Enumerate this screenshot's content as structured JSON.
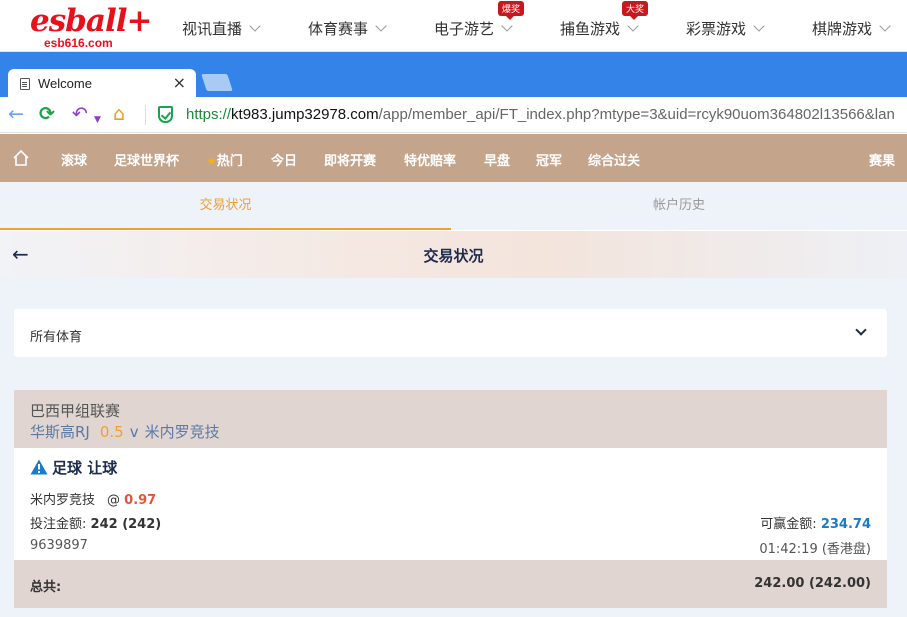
{
  "site": {
    "logo_text": "esball+",
    "logo_domain": "esb616.com",
    "nav": [
      {
        "label": "视讯直播",
        "badge": ""
      },
      {
        "label": "体育赛事",
        "badge": ""
      },
      {
        "label": "电子游艺",
        "badge": "爆奖"
      },
      {
        "label": "捕鱼游戏",
        "badge": "大奖"
      },
      {
        "label": "彩票游戏",
        "badge": ""
      },
      {
        "label": "棋牌游戏",
        "badge": ""
      }
    ]
  },
  "browser": {
    "tab_title": "Welcome",
    "url_scheme": "https://",
    "url_host": "kt983.jump32978.com",
    "url_path": "/app/member_api/FT_index.php?mtype=3&uid=rcyk90uom364802l13566&lan"
  },
  "categories": [
    "滚球",
    "足球世界杯",
    "热门",
    "今日",
    "即将开赛",
    "特优赔率",
    "早盘",
    "冠军",
    "综合过关",
    "赛果"
  ],
  "subtabs": {
    "active": "交易状况",
    "inactive": "帐户历史"
  },
  "page_title": "交易状况",
  "sport_filter": "所有体育",
  "bet": {
    "league": "巴西甲组联赛",
    "home_team": "华斯高RJ",
    "handicap": "0.5",
    "vs": "v",
    "away_team": "米内罗竞技",
    "bet_type": "足球 让球",
    "selection": "米内罗竞技",
    "at": "@",
    "odds": "0.97",
    "stake_label": "投注金额:",
    "stake_value": "242 (242)",
    "win_label": "可赢金额:",
    "win_value": "234.74",
    "ticket_id": "9639897",
    "time": "01:42:19 (香港盘)"
  },
  "total": {
    "label": "总共:",
    "value": "242.00 (242.00)"
  },
  "colors": {
    "brand": "#e8101a",
    "category_bar": "#c4a58c",
    "accent": "#f0a030",
    "win": "#1a7cc9",
    "odds": "#e2553c"
  }
}
